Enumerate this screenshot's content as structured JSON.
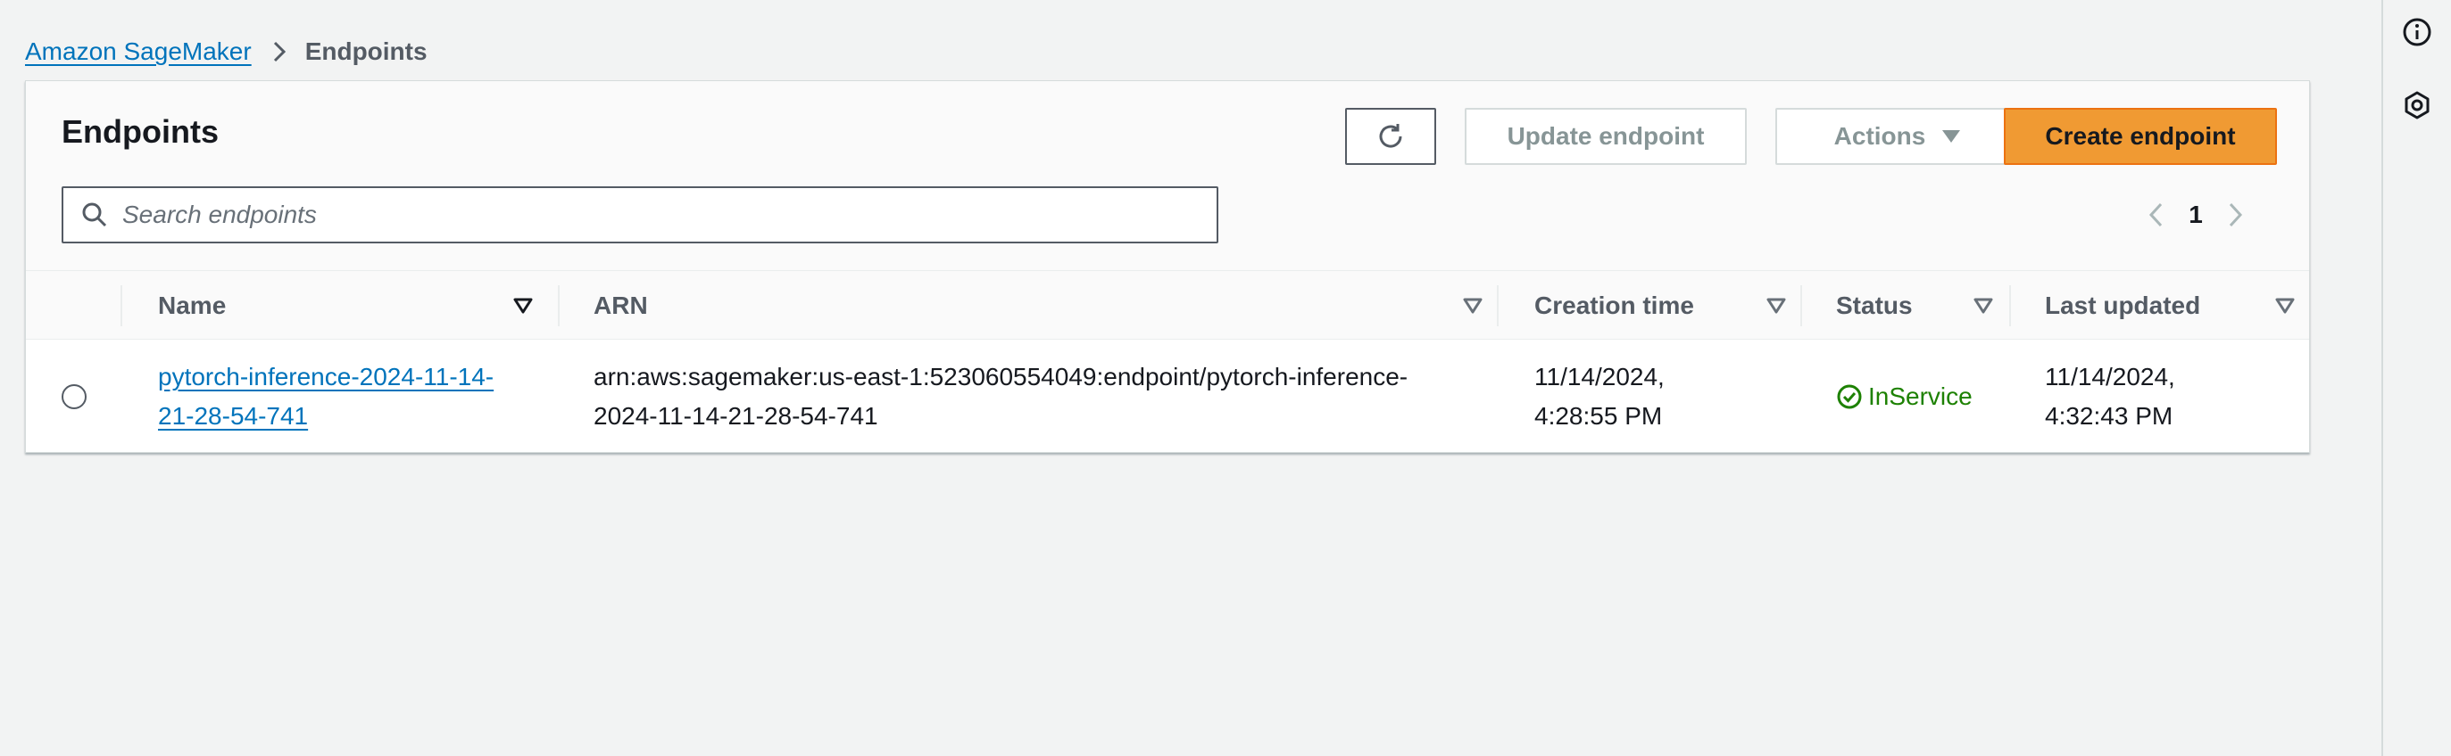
{
  "breadcrumb": {
    "root": "Amazon SageMaker",
    "current": "Endpoints"
  },
  "panel": {
    "title": "Endpoints",
    "buttons": {
      "update": "Update endpoint",
      "actions": "Actions",
      "create": "Create endpoint"
    },
    "search": {
      "placeholder": "Search endpoints",
      "value": ""
    },
    "pagination": {
      "current_page": "1"
    }
  },
  "table": {
    "columns": [
      "Name",
      "ARN",
      "Creation time",
      "Status",
      "Last updated"
    ],
    "rows": [
      {
        "name_line1": "pytorch-inference-2024-11-14-",
        "name_line2": "21-28-54-741",
        "arn_line1": "arn:aws:sagemaker:us-east-1:523060554049:endpoint/pytorch-inference-",
        "arn_line2": "2024-11-14-21-28-54-741",
        "created_line1": "11/14/2024,",
        "created_line2": "4:28:55 PM",
        "status": "InService",
        "updated_line1": "11/14/2024,",
        "updated_line2": "4:32:43 PM"
      }
    ]
  },
  "colors": {
    "link": "#0073bb",
    "primary_button": "#f09a33",
    "status_ok": "#1d8102",
    "background": "#f2f3f3"
  },
  "icons": {
    "rail": [
      "info-icon",
      "settings-hexagon-icon"
    ],
    "toolbar": [
      "refresh-icon",
      "caret-down-icon"
    ],
    "search": "search-icon",
    "pagination": [
      "chevron-left-icon",
      "chevron-right-icon"
    ],
    "status": "check-circle-icon"
  }
}
